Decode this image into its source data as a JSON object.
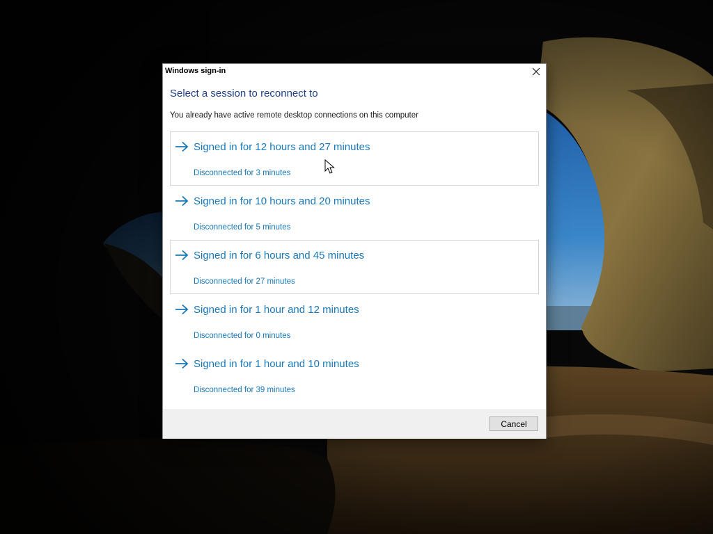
{
  "dialog": {
    "title": "Windows sign-in",
    "heading": "Select a session to reconnect to",
    "subtext": "You already have active remote desktop connections on this computer",
    "close_icon": "close-icon",
    "arrow_icon": "arrow-right-icon",
    "sessions": [
      {
        "title": "Signed in for 12 hours and 27 minutes",
        "status": "Disconnected for 3 minutes"
      },
      {
        "title": "Signed in for 10 hours and 20 minutes",
        "status": "Disconnected for 5 minutes"
      },
      {
        "title": "Signed in for 6 hours and 45 minutes",
        "status": "Disconnected for 27 minutes"
      },
      {
        "title": "Signed in for 1 hour and 12 minutes",
        "status": "Disconnected for 0 minutes"
      },
      {
        "title": "Signed in for 1 hour and 10 minutes",
        "status": "Disconnected for 39 minutes"
      }
    ],
    "cancel_label": "Cancel"
  },
  "colors": {
    "heading": "#1e3f8a",
    "link": "#1878b8",
    "footer": "#f0f0f0"
  }
}
